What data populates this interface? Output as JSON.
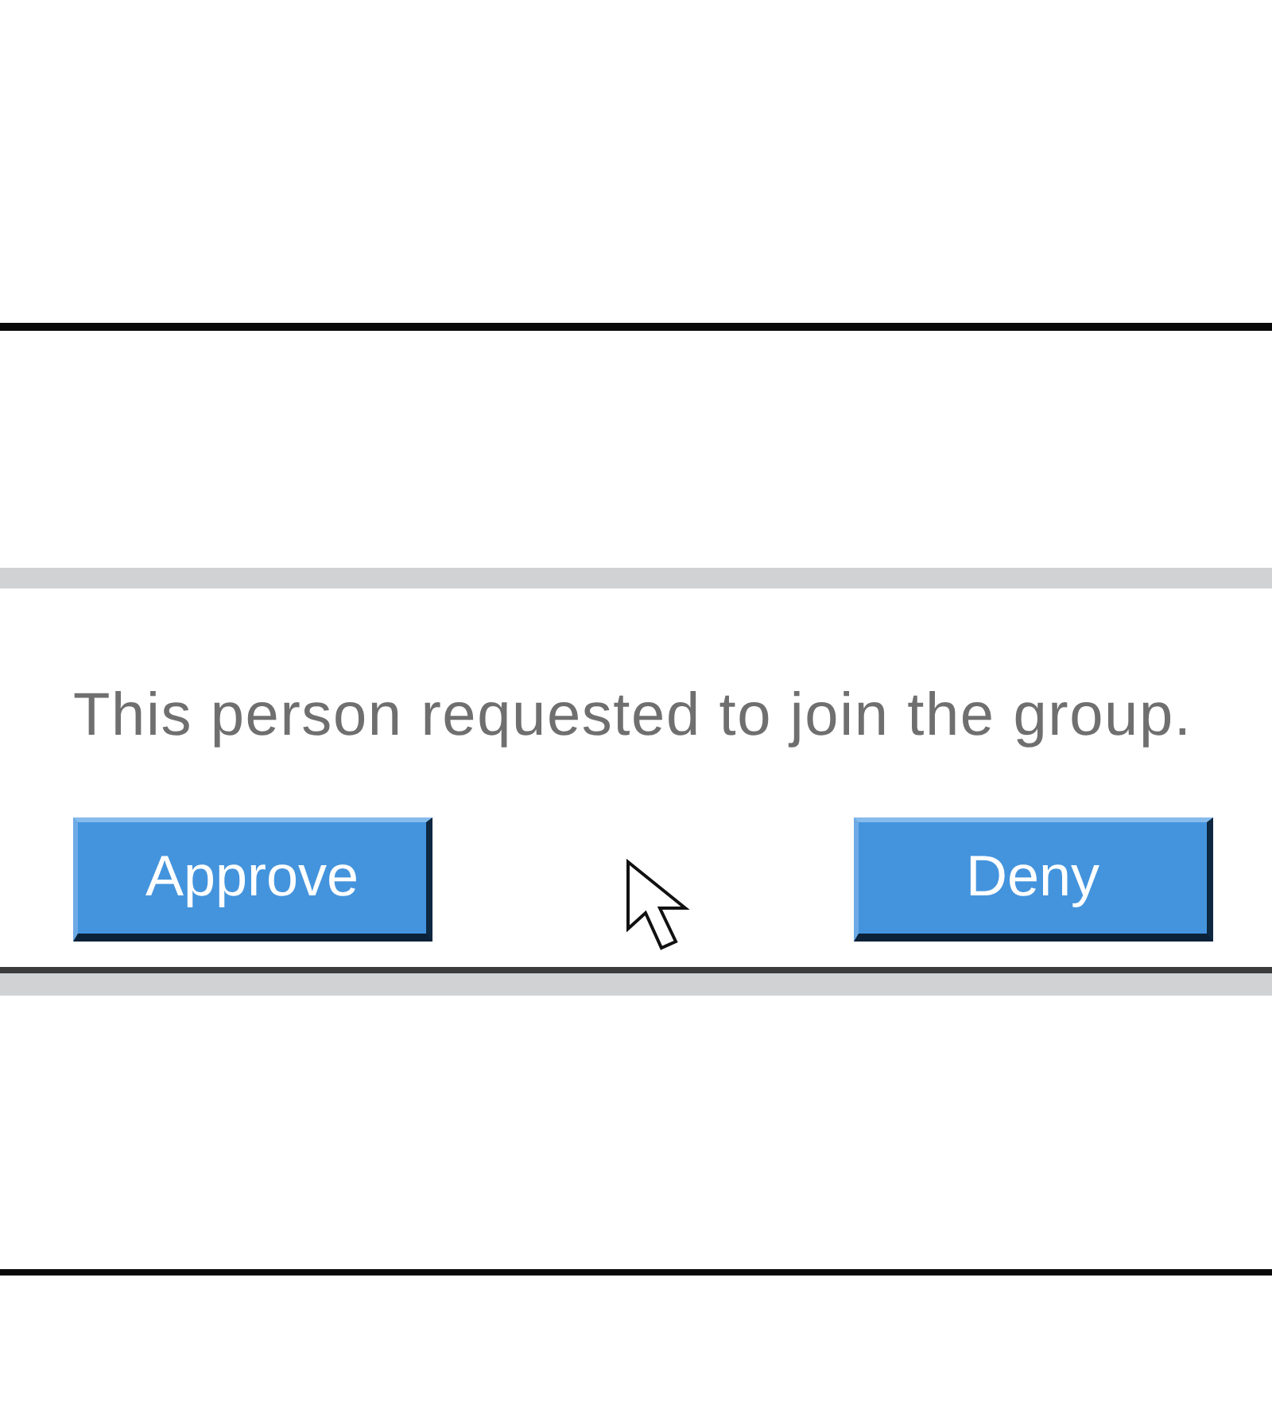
{
  "dialog": {
    "message": "This person requested to join the group.",
    "buttons": [
      {
        "label": "Approve"
      },
      {
        "label": "Deny"
      }
    ]
  }
}
